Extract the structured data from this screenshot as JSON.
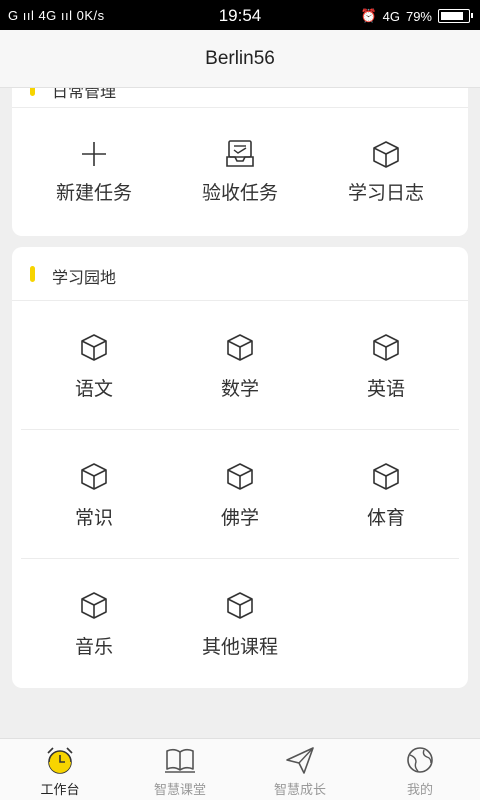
{
  "status_bar": {
    "left_text": "G ııl 4G ııl 0K/s",
    "time": "19:54",
    "network": "4G",
    "battery": "79%"
  },
  "header": {
    "title": "Berlin56"
  },
  "card_common": {
    "title": "日常管理",
    "items": [
      {
        "label": "新建任务",
        "icon": "plus-icon"
      },
      {
        "label": "验收任务",
        "icon": "inbox-icon"
      },
      {
        "label": "学习日志",
        "icon": "cube-icon"
      }
    ]
  },
  "card_study": {
    "title": "学习园地",
    "items": [
      {
        "label": "语文",
        "icon": "cube-icon"
      },
      {
        "label": "数学",
        "icon": "cube-icon"
      },
      {
        "label": "英语",
        "icon": "cube-icon"
      },
      {
        "label": "常识",
        "icon": "cube-icon"
      },
      {
        "label": "佛学",
        "icon": "cube-icon"
      },
      {
        "label": "体育",
        "icon": "cube-icon"
      },
      {
        "label": "音乐",
        "icon": "cube-icon"
      },
      {
        "label": "其他课程",
        "icon": "cube-icon"
      }
    ]
  },
  "tabbar": {
    "tabs": [
      {
        "label": "工作台",
        "icon": "alarm-clock-icon",
        "active": true
      },
      {
        "label": "智慧课堂",
        "icon": "open-book-icon",
        "active": false
      },
      {
        "label": "智慧成长",
        "icon": "paper-plane-icon",
        "active": false
      },
      {
        "label": "我的",
        "icon": "globe-icon",
        "active": false
      }
    ]
  },
  "colors": {
    "accent": "#f7d400",
    "background": "#efefef",
    "text": "#333333"
  }
}
